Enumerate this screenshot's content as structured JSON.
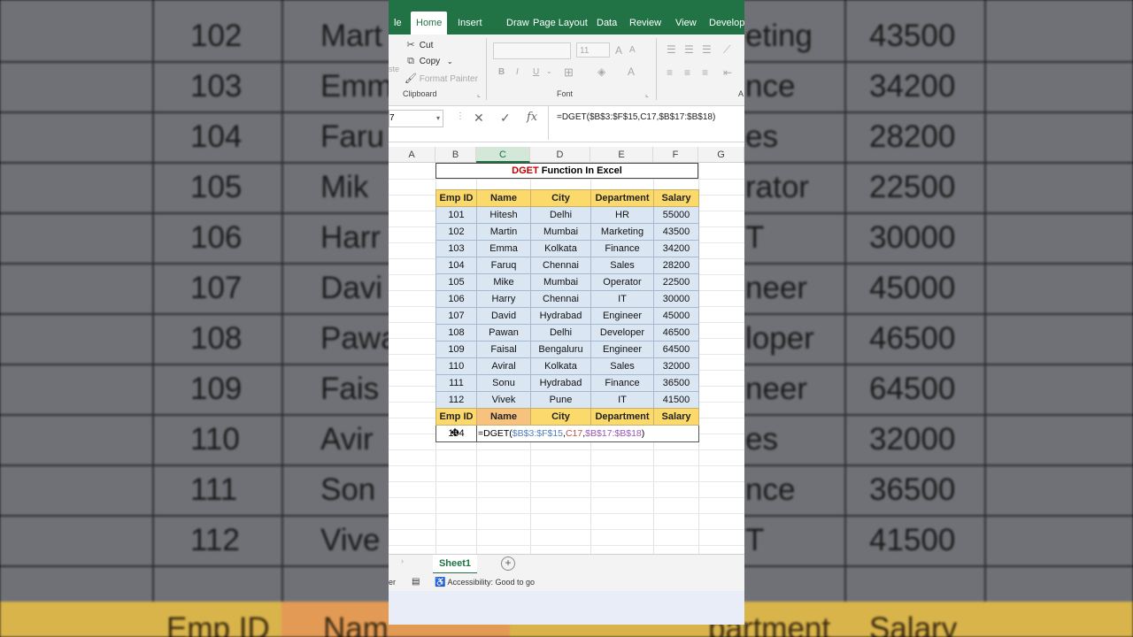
{
  "background": {
    "rows": [
      [
        "102",
        "Mart",
        "eting",
        "43500"
      ],
      [
        "103",
        "Emm",
        "nce",
        "34200"
      ],
      [
        "104",
        "Faru",
        "es",
        "28200"
      ],
      [
        "105",
        "Mik",
        "rator",
        "22500"
      ],
      [
        "106",
        "Harr",
        "T",
        "30000"
      ],
      [
        "107",
        "Davi",
        "neer",
        "45000"
      ],
      [
        "108",
        "Pawa",
        "loper",
        "46500"
      ],
      [
        "109",
        "Fais",
        "neer",
        "64500"
      ],
      [
        "110",
        "Avir",
        "es",
        "32000"
      ],
      [
        "111",
        "Son",
        "nce",
        "36500"
      ],
      [
        "112",
        "Vive",
        "T",
        "41500"
      ]
    ],
    "header": [
      "Emp ID",
      "Nam",
      "partment",
      "Salary"
    ]
  },
  "ribbon": {
    "tabs": [
      "le",
      "Home",
      "Insert",
      "Draw",
      "Page Layout",
      "Data",
      "Review",
      "View",
      "Develop"
    ],
    "active_tab": "Home",
    "clipboard": {
      "cut": "Cut",
      "copy": "Copy",
      "format_painter": "Format Painter",
      "group": "Clipboard",
      "paste_fragment": "ste"
    },
    "font": {
      "font_size": "11",
      "group": "Font",
      "bold": "B",
      "italic": "I",
      "underline": "U"
    },
    "alignment_fragment": "A"
  },
  "formula_bar": {
    "namebox": "7",
    "cancel": "✕",
    "enter": "✓",
    "fx": "fx",
    "formula": "=DGET($B$3:$F$15,C17,$B$17:$B$18)"
  },
  "columns": [
    "A",
    "B",
    "C",
    "D",
    "E",
    "F",
    "G"
  ],
  "title": {
    "prefix": "DGET",
    "suffix": " Function In Excel"
  },
  "table": {
    "headers": [
      "Emp ID",
      "Name",
      "City",
      "Department",
      "Salary"
    ],
    "rows": [
      [
        "101",
        "Hitesh",
        "Delhi",
        "HR",
        "55000"
      ],
      [
        "102",
        "Martin",
        "Mumbai",
        "Marketing",
        "43500"
      ],
      [
        "103",
        "Emma",
        "Kolkata",
        "Finance",
        "34200"
      ],
      [
        "104",
        "Faruq",
        "Chennai",
        "Sales",
        "28200"
      ],
      [
        "105",
        "Mike",
        "Mumbai",
        "Operator",
        "22500"
      ],
      [
        "106",
        "Harry",
        "Chennai",
        "IT",
        "30000"
      ],
      [
        "107",
        "David",
        "Hydrabad",
        "Engineer",
        "45000"
      ],
      [
        "108",
        "Pawan",
        "Delhi",
        "Developer",
        "46500"
      ],
      [
        "109",
        "Faisal",
        "Bengaluru",
        "Engineer",
        "64500"
      ],
      [
        "110",
        "Aviral",
        "Kolkata",
        "Sales",
        "32000"
      ],
      [
        "111",
        "Sonu",
        "Hydrabad",
        "Finance",
        "36500"
      ],
      [
        "112",
        "Vivek",
        "Pune",
        "IT",
        "41500"
      ]
    ]
  },
  "criteria": {
    "headers": [
      "Emp ID",
      "Name",
      "City",
      "Department",
      "Salary"
    ],
    "emp_id": "104",
    "formula_parts": [
      "=DGET(",
      "$B$3:$F$15",
      ",",
      "C17",
      ",",
      "$B$17:$B$18",
      ")"
    ]
  },
  "colors": {
    "accent": "#217346",
    "header_fill": "#fbd96b",
    "row_fill": "#dbe6f3",
    "ref1": "#4f7fbf",
    "ref2": "#c0504d",
    "ref3": "#9b59b6"
  },
  "sheet_bar": {
    "tab": "Sheet1",
    "add": "+"
  },
  "status_bar": {
    "left": "er",
    "accessibility": "Accessibility: Good to go"
  }
}
